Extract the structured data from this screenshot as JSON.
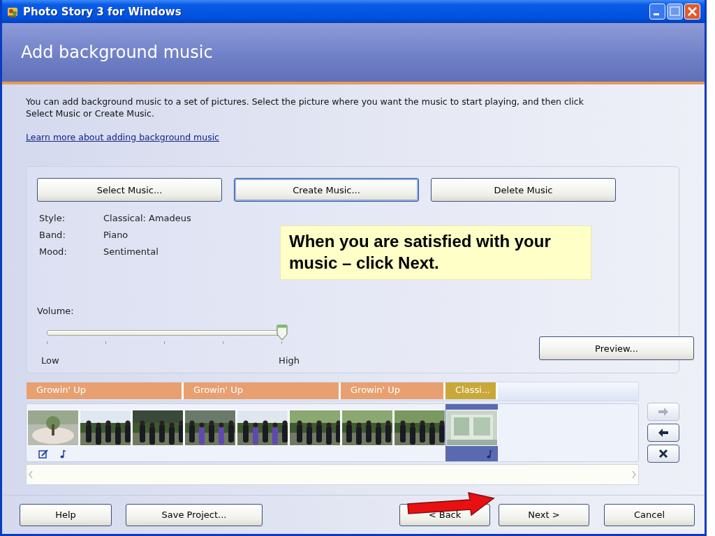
{
  "window": {
    "title": "Photo Story 3 for Windows"
  },
  "page": {
    "title": "Add background music",
    "description": "You can add background music to a set of pictures.  Select the picture where you want the music to start playing, and then click Select Music or Create Music.",
    "link": "Learn more about adding background music"
  },
  "music_buttons": [
    {
      "label": "Select Music...",
      "focused": false
    },
    {
      "label": "Create Music...",
      "focused": true
    },
    {
      "label": "Delete Music",
      "focused": false
    }
  ],
  "details": [
    {
      "label": "Style:",
      "value": "Classical: Amadeus"
    },
    {
      "label": "Band:",
      "value": "Piano"
    },
    {
      "label": "Mood:",
      "value": "Sentimental"
    }
  ],
  "callout": "When you are satisfied with your music – click Next.",
  "volume": {
    "label": "Volume:",
    "level": 1,
    "min_label": "Low",
    "max_label": "High"
  },
  "preview_button": "Preview...",
  "timeline": {
    "segments": [
      {
        "label": "Growin' Up",
        "color": "#e8a070",
        "pictures": [
          {
            "selected": false,
            "edit_icon": true,
            "music_icon": true
          },
          {
            "selected": false,
            "edit_icon": false,
            "music_icon": false
          },
          {
            "selected": false,
            "edit_icon": false,
            "music_icon": false
          }
        ]
      },
      {
        "label": "Growin' Up",
        "color": "#e8a070",
        "pictures": [
          {
            "selected": false,
            "edit_icon": false,
            "music_icon": false
          },
          {
            "selected": false,
            "edit_icon": false,
            "music_icon": false
          },
          {
            "selected": false,
            "edit_icon": false,
            "music_icon": false
          }
        ]
      },
      {
        "label": "Growin' Up",
        "color": "#e8a070",
        "pictures": [
          {
            "selected": false,
            "edit_icon": false,
            "music_icon": false
          },
          {
            "selected": false,
            "edit_icon": false,
            "music_icon": false
          }
        ]
      },
      {
        "label": "Classi...",
        "color": "#c8a838",
        "pictures": [
          {
            "selected": true,
            "edit_icon": false,
            "music_icon": true
          }
        ]
      }
    ]
  },
  "reorder_buttons": [
    {
      "kind": "right",
      "disabled": true
    },
    {
      "kind": "left",
      "disabled": false
    },
    {
      "kind": "remove",
      "disabled": false
    }
  ],
  "footer_buttons": [
    "Help",
    "Save Project..."
  ],
  "nav_buttons": [
    "< Back",
    "Next >",
    "Cancel"
  ]
}
